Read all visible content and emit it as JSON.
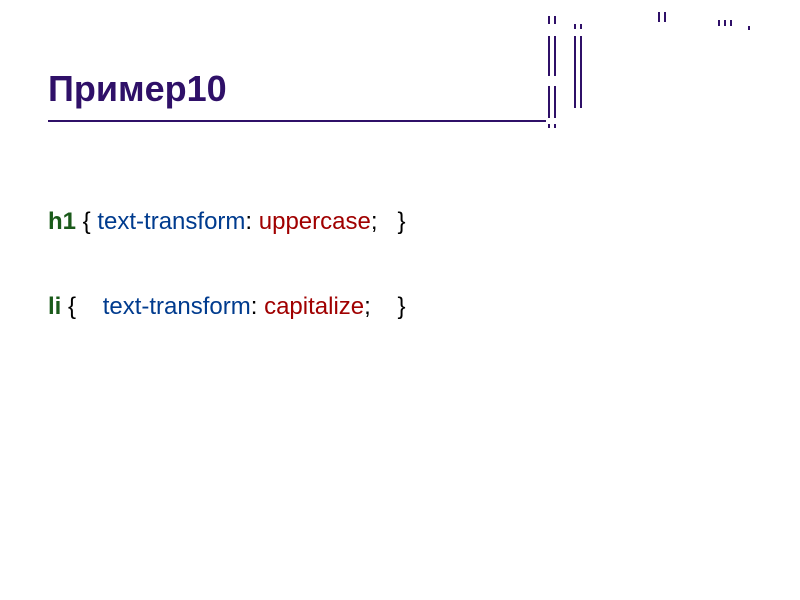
{
  "title": "Пример10",
  "code": {
    "line1": {
      "selector": "h1",
      "brace_open": " { ",
      "property": "text-transform",
      "colon": ": ",
      "value": "uppercase",
      "semi": ";   ",
      "brace_close": "}"
    },
    "line2": {
      "selector": "li",
      "brace_open": " {    ",
      "property": "text-transform",
      "colon": ": ",
      "value": "capitalize",
      "semi": ";    ",
      "brace_close": "}"
    }
  }
}
